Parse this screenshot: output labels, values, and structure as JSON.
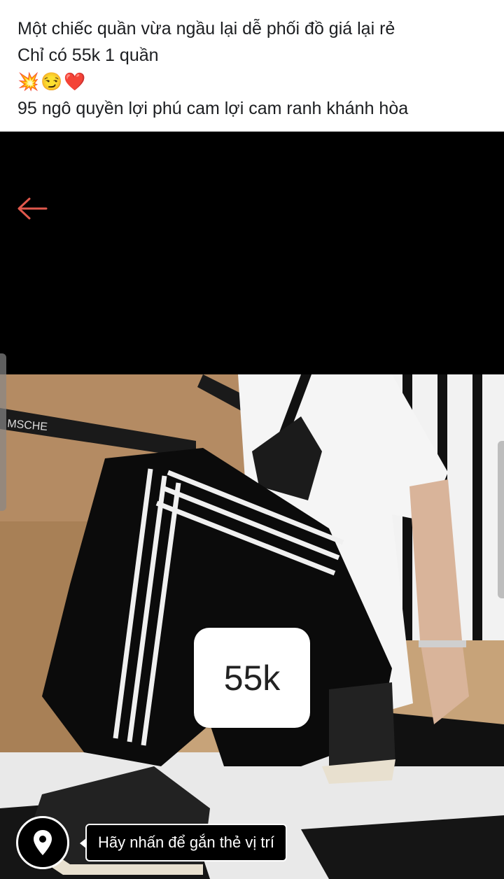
{
  "post": {
    "line1": "Một chiếc quần vừa ngầu lại dễ phối đồ giá lại rẻ",
    "line2": "Chỉ có 55k 1 quần",
    "emojis": [
      "💥",
      "😏",
      "❤️"
    ],
    "line4": "95 ngô quyền lợi phú cam lợi cam ranh khánh hòa"
  },
  "photo": {
    "price_sticker": "55k",
    "box_tape_text": "MSCHE"
  },
  "location": {
    "tooltip": "Hãy nhấn để gắn thẻ vị trí",
    "icon": "location-pin-icon"
  },
  "nav": {
    "back_icon": "back-arrow-icon"
  },
  "colors": {
    "back_arrow": "#e0584c",
    "caption_bg": "#ffffff",
    "viewer_bg": "#000000"
  }
}
